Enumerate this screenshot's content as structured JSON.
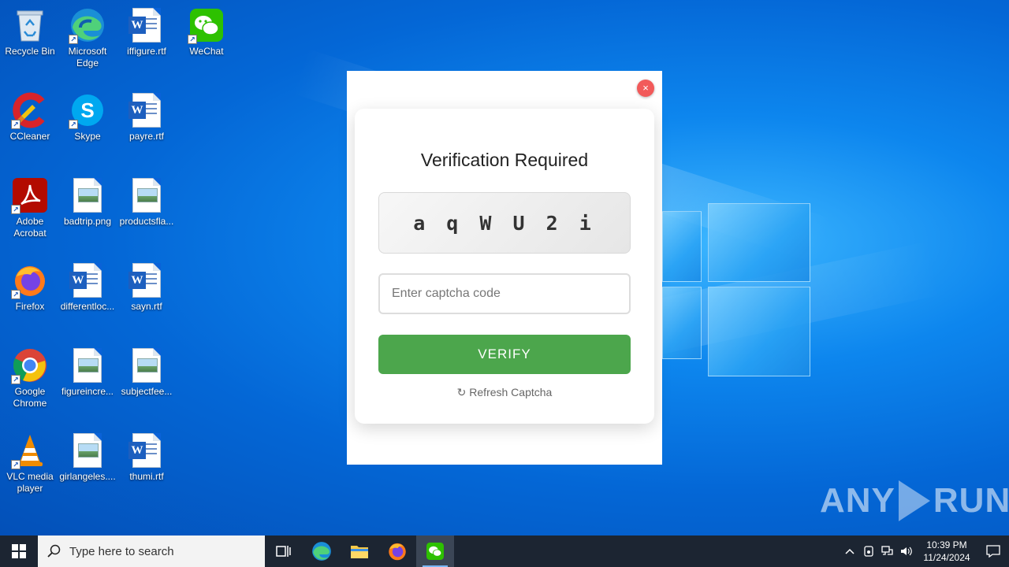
{
  "desktop": {
    "icons": [
      {
        "label": "Recycle Bin",
        "icon": "recycle-bin-icon"
      },
      {
        "label": "Microsoft Edge",
        "icon": "edge-icon"
      },
      {
        "label": "iffigure.rtf",
        "icon": "word-document-icon"
      },
      {
        "label": "WeChat",
        "icon": "wechat-icon"
      },
      {
        "label": "CCleaner",
        "icon": "ccleaner-icon"
      },
      {
        "label": "Skype",
        "icon": "skype-icon"
      },
      {
        "label": "payre.rtf",
        "icon": "word-document-icon"
      },
      {
        "label": "Adobe Acrobat",
        "icon": "adobe-acrobat-icon"
      },
      {
        "label": "badtrip.png",
        "icon": "image-file-icon"
      },
      {
        "label": "productsfla...",
        "icon": "image-file-icon"
      },
      {
        "label": "Firefox",
        "icon": "firefox-icon"
      },
      {
        "label": "differentloc...",
        "icon": "word-document-icon"
      },
      {
        "label": "sayn.rtf",
        "icon": "word-document-icon"
      },
      {
        "label": "Google Chrome",
        "icon": "chrome-icon"
      },
      {
        "label": "figureincre...",
        "icon": "image-file-icon"
      },
      {
        "label": "subjectfee...",
        "icon": "image-file-icon"
      },
      {
        "label": "VLC media player",
        "icon": "vlc-icon"
      },
      {
        "label": "girlangeles....",
        "icon": "image-file-icon"
      },
      {
        "label": "thumi.rtf",
        "icon": "word-document-icon"
      }
    ]
  },
  "popup": {
    "close_label": "×",
    "title": "Verification Required",
    "captcha_code": "a q W U 2 i",
    "input_placeholder": "Enter captcha code",
    "verify_label": "VERIFY",
    "refresh_label": "↻ Refresh Captcha"
  },
  "watermark": {
    "left": "ANY",
    "right": "RUN"
  },
  "taskbar": {
    "search_placeholder": "Type here to search",
    "pinned": [
      "task-view-icon",
      "edge-icon",
      "file-explorer-icon",
      "firefox-icon",
      "wechat-icon"
    ],
    "clock_time": "10:39 PM",
    "clock_date": "11/24/2024"
  },
  "colors": {
    "verify_button": "#4ca64c",
    "close_button": "#f25a5a",
    "taskbar": "#1c2532",
    "desktop": "#0a62d8"
  }
}
